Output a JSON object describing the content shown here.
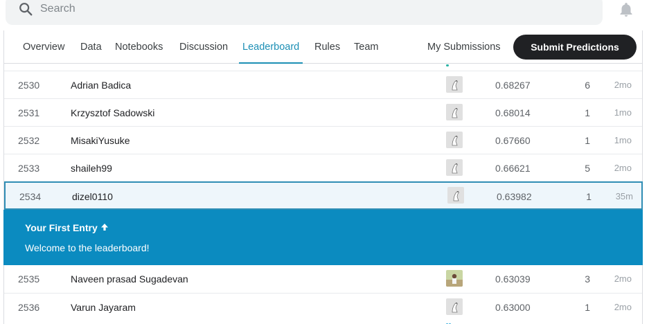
{
  "search": {
    "placeholder": "Search"
  },
  "tabs": [
    {
      "label": "Overview"
    },
    {
      "label": "Data"
    },
    {
      "label": "Notebooks"
    },
    {
      "label": "Discussion"
    },
    {
      "label": "Leaderboard"
    },
    {
      "label": "Rules"
    },
    {
      "label": "Team"
    },
    {
      "label": "My Submissions"
    }
  ],
  "submit_label": "Submit Predictions",
  "accent_color": "#1c8fb5",
  "banner": {
    "title": "Your First Entry",
    "arrow": "🡅",
    "subtitle": "Welcome to the leaderboard!",
    "color": "#0b8bc0"
  },
  "rows": [
    {
      "rank": "2530",
      "name": "Adrian Badica",
      "score": "0.68267",
      "entries": "6",
      "last": "2mo"
    },
    {
      "rank": "2531",
      "name": "Krzysztof Sadowski",
      "score": "0.68014",
      "entries": "1",
      "last": "1mo"
    },
    {
      "rank": "2532",
      "name": "MisakiYusuke",
      "score": "0.67660",
      "entries": "1",
      "last": "1mo"
    },
    {
      "rank": "2533",
      "name": "shaileh99",
      "score": "0.66621",
      "entries": "5",
      "last": "2mo"
    },
    {
      "rank": "2534",
      "name": "dizel0110",
      "score": "0.63982",
      "entries": "1",
      "last": "35m"
    },
    {
      "rank": "2535",
      "name": "Naveen prasad Sugadevan",
      "score": "0.63039",
      "entries": "3",
      "last": "2mo"
    },
    {
      "rank": "2536",
      "name": "Varun Jayaram",
      "score": "0.63000",
      "entries": "1",
      "last": "2mo"
    }
  ]
}
